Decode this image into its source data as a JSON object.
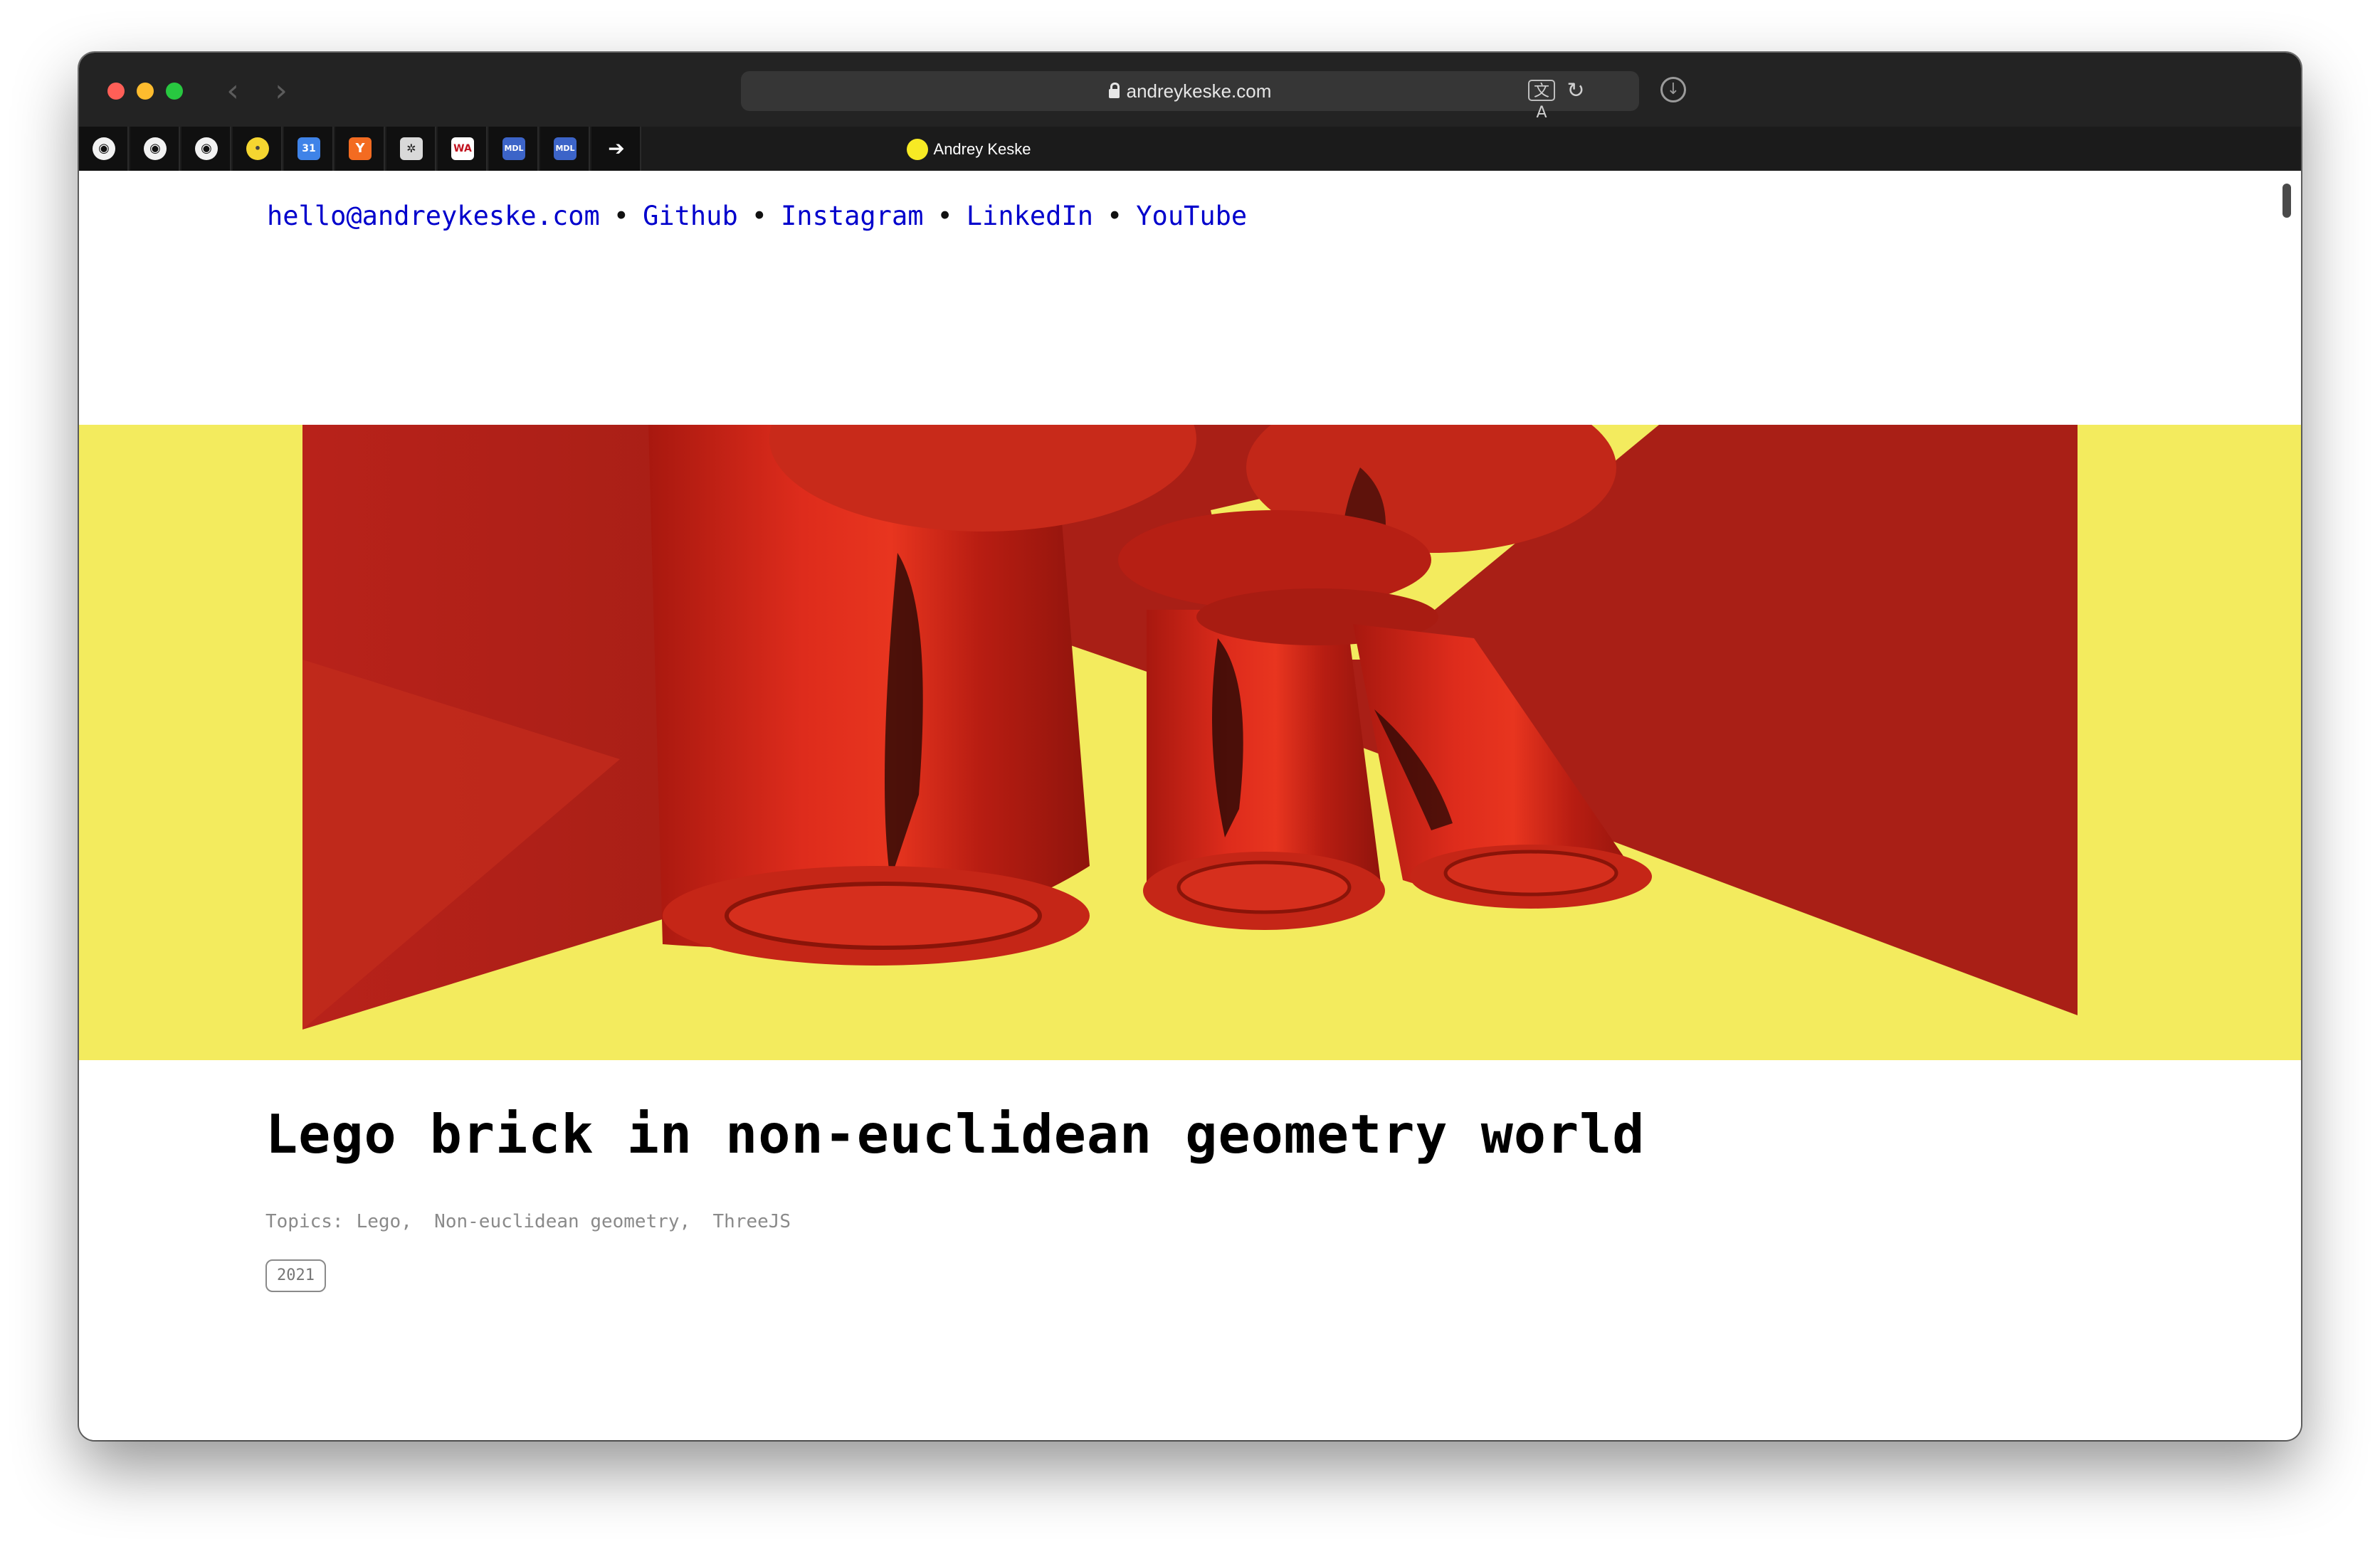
{
  "browser": {
    "url": "andreykeske.com",
    "back_label": "‹",
    "forward_label": "›",
    "translate_label": "文A",
    "reload_label": "↻",
    "download_label": "↓",
    "active_tab_title": "Andrey Keske",
    "pinned_tabs": [
      {
        "icon": "github-icon",
        "glyph": "◉"
      },
      {
        "icon": "github-icon",
        "glyph": "◉"
      },
      {
        "icon": "github-icon",
        "glyph": "◉"
      },
      {
        "icon": "yellow-dot-icon",
        "glyph": "•"
      },
      {
        "icon": "calendar-icon",
        "glyph": "31"
      },
      {
        "icon": "hacker-news-icon",
        "glyph": "Y"
      },
      {
        "icon": "bug-icon",
        "glyph": "✲"
      },
      {
        "icon": "wa-icon",
        "glyph": "WA"
      },
      {
        "icon": "mdl-icon",
        "glyph": "MDL"
      },
      {
        "icon": "mdl-icon",
        "glyph": "MDL"
      },
      {
        "icon": "arrow-icon",
        "glyph": "➔"
      }
    ]
  },
  "nav": {
    "links": [
      "hello@andreykeske.com",
      "Github",
      "Instagram",
      "LinkedIn",
      "YouTube"
    ],
    "separator": "•"
  },
  "article": {
    "title": "Lego brick in non-euclidean geometry world",
    "topics_label": "Topics:",
    "topics": [
      "Lego,",
      "Non-euclidean geometry,",
      "ThreeJS"
    ],
    "year": "2021"
  },
  "colors": {
    "hero_background": "#f3eb5e",
    "brick_red": "#c4251a",
    "link_blue": "#0000cc"
  }
}
